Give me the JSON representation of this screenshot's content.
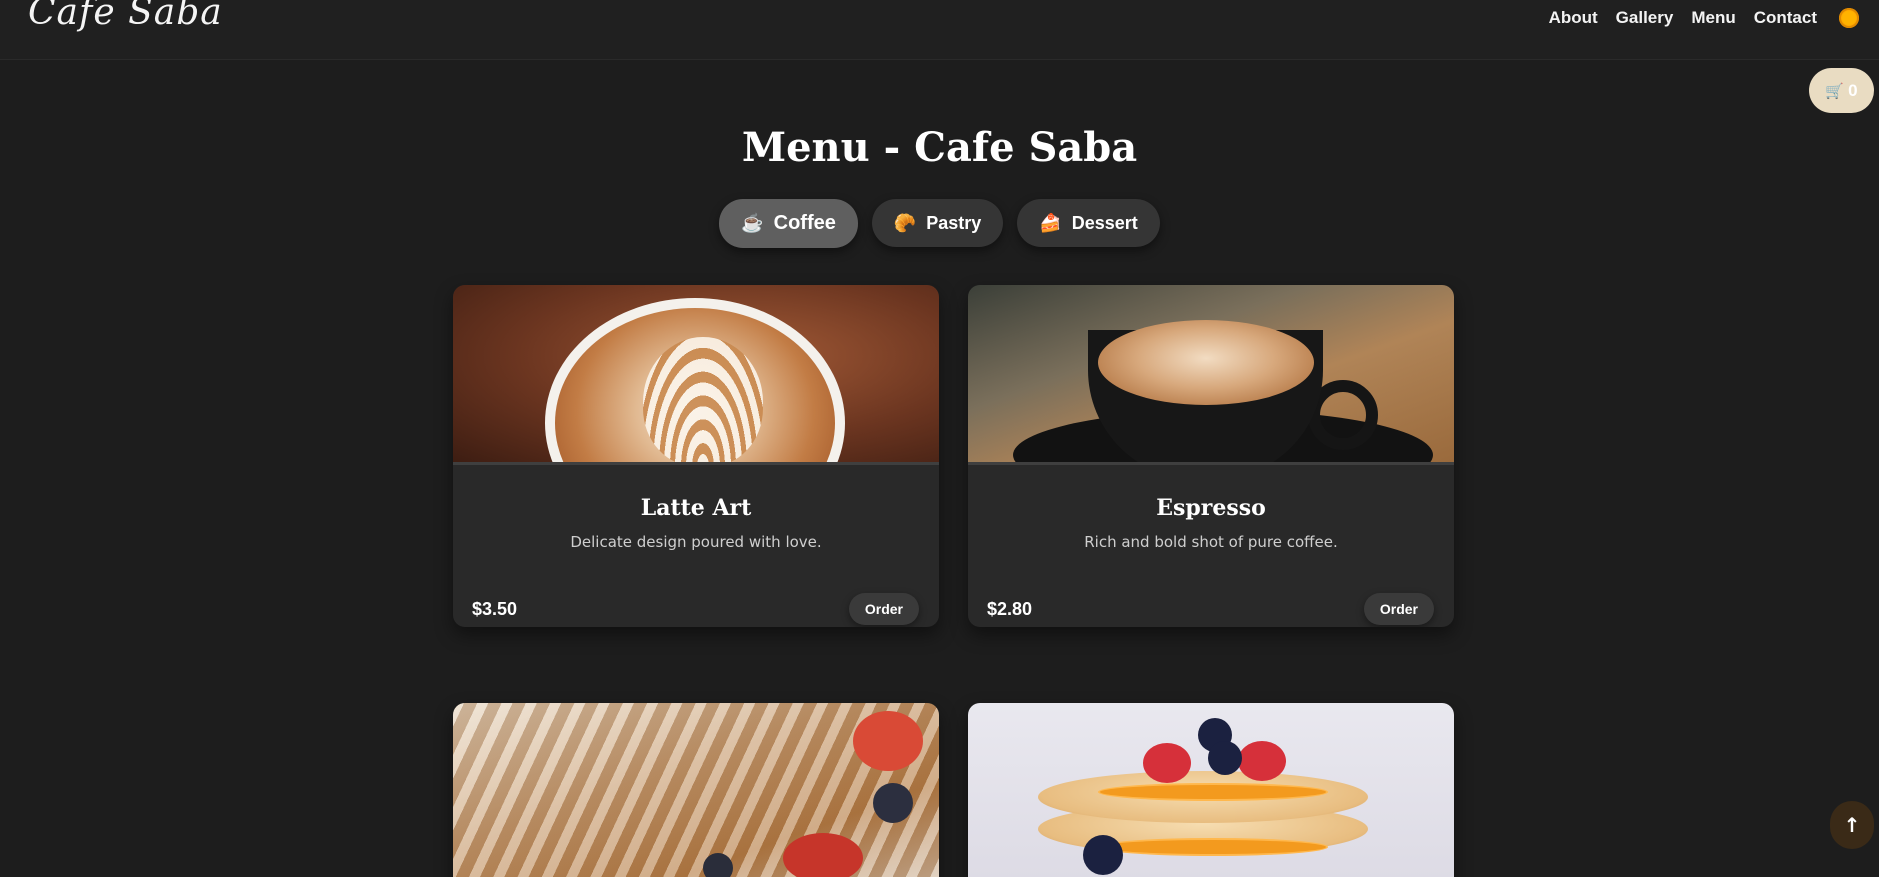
{
  "header": {
    "logo": "Cafe Saba",
    "nav": [
      "About",
      "Gallery",
      "Menu",
      "Contact"
    ],
    "theme_icon": "sun-icon"
  },
  "cart": {
    "icon": "cart-icon",
    "count": "0"
  },
  "page_title": "Menu - Cafe Saba",
  "tabs": [
    {
      "label": "Coffee",
      "icon": "coffee-cup-icon",
      "active": true
    },
    {
      "label": "Pastry",
      "icon": "croissant-icon",
      "active": false
    },
    {
      "label": "Dessert",
      "icon": "cake-icon",
      "active": false
    }
  ],
  "items": [
    {
      "name": "Latte Art",
      "description": "Delicate design poured with love.",
      "price": "$3.50",
      "button": "Order"
    },
    {
      "name": "Espresso",
      "description": "Rich and bold shot of pure coffee.",
      "price": "$2.80",
      "button": "Order"
    }
  ],
  "scroll_top": {
    "icon": "arrow-up-icon",
    "label": "↑"
  },
  "colors": {
    "background": "#1d1d1d",
    "card": "#292929",
    "cart": "#e9dcc2",
    "active_tab": "#5f5f5f"
  }
}
